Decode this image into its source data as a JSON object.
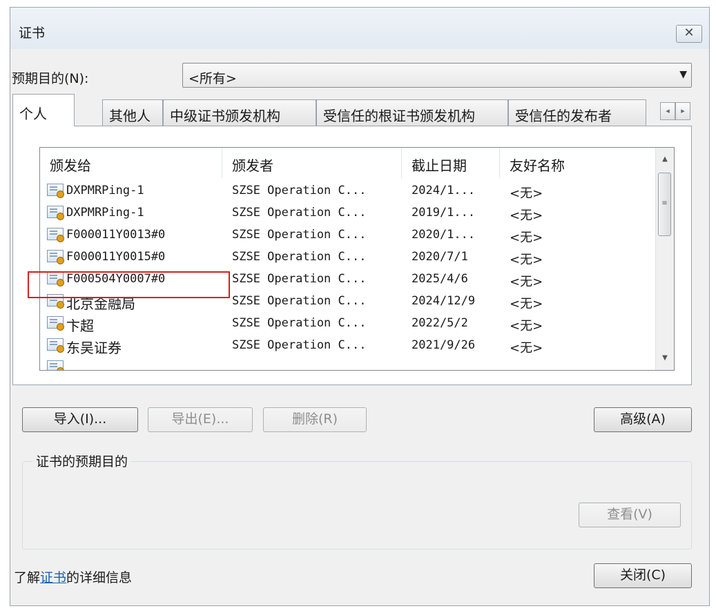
{
  "window": {
    "title": "证书",
    "close_icon": "close-icon"
  },
  "purpose": {
    "label": "预期目的(N):",
    "selected": "<所有>"
  },
  "tabs": [
    {
      "label": "个人",
      "active": true
    },
    {
      "label": "其他人"
    },
    {
      "label": "中级证书颁发机构"
    },
    {
      "label": "受信任的根证书颁发机构"
    },
    {
      "label": "受信任的发布者"
    }
  ],
  "tab_scroll": {
    "left": "◂",
    "right": "▸"
  },
  "list": {
    "columns": [
      "颁发给",
      "颁发者",
      "截止日期",
      "友好名称"
    ],
    "rows": [
      {
        "issued_to": "DXPMRPing-1",
        "issuer": "SZSE Operation C...",
        "expiry": "2024/1...",
        "friendly": "<无>"
      },
      {
        "issued_to": "DXPMRPing-1",
        "issuer": "SZSE Operation C...",
        "expiry": "2019/1...",
        "friendly": "<无>"
      },
      {
        "issued_to": "F000011Y0013#0",
        "issuer": "SZSE Operation C...",
        "expiry": "2020/1...",
        "friendly": "<无>"
      },
      {
        "issued_to": "F000011Y0015#0",
        "issuer": "SZSE Operation C...",
        "expiry": "2020/7/1",
        "friendly": "<无>"
      },
      {
        "issued_to": "F000504Y0007#0",
        "issuer": "SZSE Operation C...",
        "expiry": "2025/4/6",
        "friendly": "<无>"
      },
      {
        "issued_to": "北京金融局",
        "issuer": "SZSE Operation C...",
        "expiry": "2024/12/9",
        "friendly": "<无>"
      },
      {
        "issued_to": "卞超",
        "issuer": "SZSE Operation C...",
        "expiry": "2022/5/2",
        "friendly": "<无>"
      },
      {
        "issued_to": "东吴证券",
        "issuer": "SZSE Operation C...",
        "expiry": "2021/9/26",
        "friendly": "<无>"
      }
    ]
  },
  "buttons": {
    "import": "导入(I)...",
    "export": "导出(E)...",
    "remove": "删除(R)",
    "advanced": "高级(A)",
    "view": "查看(V)",
    "close": "关闭(C)"
  },
  "purposes_group": {
    "label": "证书的预期目的"
  },
  "footer": {
    "prefix": "了解",
    "link": "证书",
    "suffix": "的详细信息"
  }
}
